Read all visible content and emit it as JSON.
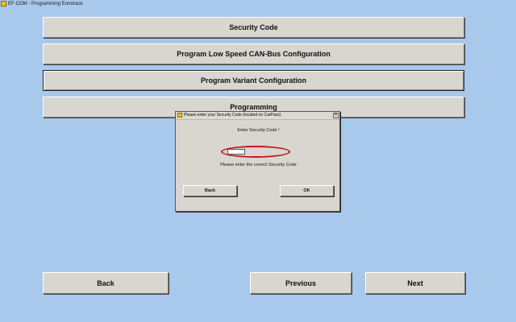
{
  "window": {
    "title": "EF-COM - Programming Eurotrace"
  },
  "menu": {
    "items": [
      {
        "label": "Security Code"
      },
      {
        "label": "Program Low Speed CAN-Bus Configuration"
      },
      {
        "label": "Program Variant Configuration"
      },
      {
        "label": "Programming"
      }
    ]
  },
  "dialog": {
    "title": "Please enter your Security Code (located on CarPass)",
    "close_glyph": "×",
    "prompt": "Enter Security Code !",
    "code_value": "",
    "hint": "Please enter the correct Security Code",
    "back_label": "Back",
    "ok_label": "OK",
    "highlight_color": "#c0161a"
  },
  "footer": {
    "back_label": "Back",
    "previous_label": "Previous",
    "next_label": "Next"
  },
  "colors": {
    "background": "#a8c8ec",
    "button_face": "#d9d6cf"
  }
}
